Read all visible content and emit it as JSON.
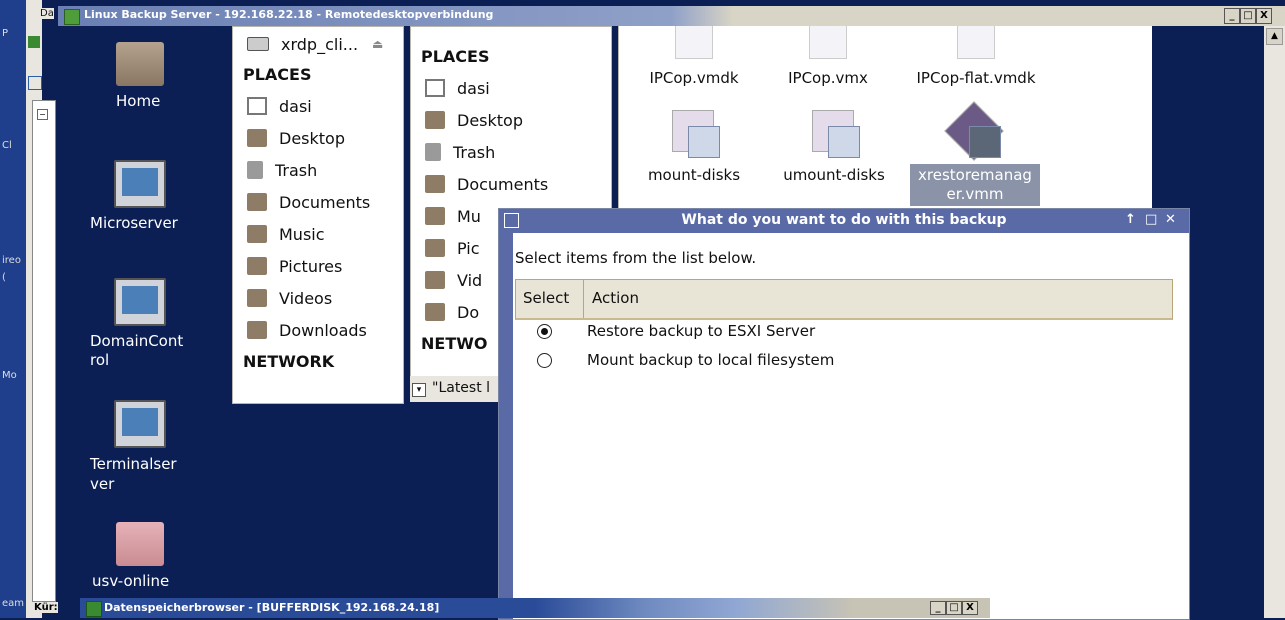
{
  "rdp": {
    "title": "Linux Backup Server - 192.168.22.18 - Remotedesktopverbindung",
    "da_label": "Da",
    "min": "_",
    "max": "□",
    "close": "X"
  },
  "host": {
    "left_labels": [
      "P",
      "Cl",
      "ireo",
      "(",
      "Mo",
      "eam"
    ],
    "kur_label": "Kür:"
  },
  "desktop_icons": [
    {
      "label": "Home",
      "kind": "folder"
    },
    {
      "label": "Microserver",
      "kind": "monitor"
    },
    {
      "label": "DomainCont rol",
      "kind": "monitor"
    },
    {
      "label": "Terminalser ver",
      "kind": "monitor"
    },
    {
      "label": "usv-online",
      "kind": "folder-pink"
    }
  ],
  "pane1": {
    "drive": "xrdp_cli...",
    "places_header": "PLACES",
    "places": [
      "dasi",
      "Desktop",
      "Trash",
      "Documents",
      "Music",
      "Pictures",
      "Videos",
      "Downloads"
    ],
    "network_header": "NETWORK"
  },
  "pane2": {
    "places_header": "PLACES",
    "places": [
      "dasi",
      "Desktop",
      "Trash",
      "Documents",
      "Mu",
      "Pic",
      "Vid",
      "Do"
    ],
    "network_header": "NETWO",
    "path_text": "\"Latest l"
  },
  "files": [
    {
      "label": "IPCop.vmdk"
    },
    {
      "label": "IPCop.vmx"
    },
    {
      "label": "IPCop-flat.vmdk"
    },
    {
      "label": "mount-disks"
    },
    {
      "label": "umount-disks"
    },
    {
      "label": "xrestoremanag er.vmm",
      "selected": true
    }
  ],
  "dialog": {
    "title": "What do you want to do with this backup",
    "title_controls": [
      "↑",
      "□",
      "✕"
    ],
    "subtitle": "Select items from the list below.",
    "col_select": "Select",
    "col_action": "Action",
    "options": [
      {
        "label": "Restore backup to ESXI Server",
        "selected": true
      },
      {
        "label": "Mount backup to local filesystem",
        "selected": false
      }
    ]
  },
  "bottom_window": {
    "title": "Datenspeicherbrowser - [BUFFERDISK_192.168.24.18]"
  }
}
